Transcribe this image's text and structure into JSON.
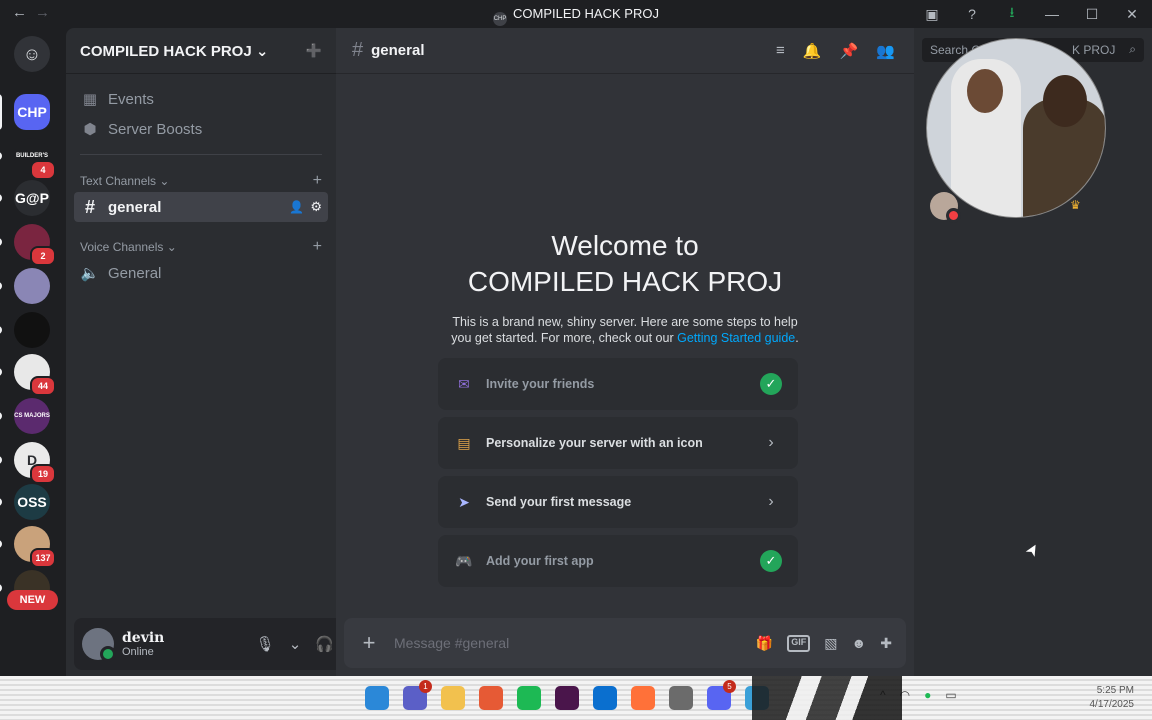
{
  "titlebar": {
    "back_icon": "←",
    "forward_icon": "→",
    "server_icon_text": "CHP",
    "title": "COMPILED HACK PROJ",
    "inbox_icon": "▣",
    "help_icon": "?",
    "download_icon": "⭳",
    "minimize": "—",
    "maximize": "☐",
    "close": "✕"
  },
  "guilds": {
    "discord_home_icon": "☺",
    "active_label": "CHP",
    "items": [
      {
        "label": "CHP",
        "color": "#5865f2",
        "badge": ""
      },
      {
        "label": "BUILDER'S",
        "color": "#1e1f22",
        "badge": "4"
      },
      {
        "label": "G@P",
        "color": "#2b2d31",
        "badge": ""
      },
      {
        "label": "",
        "color": "#7a2540",
        "badge": "2"
      },
      {
        "label": "",
        "color": "#8a86b5",
        "badge": ""
      },
      {
        "label": "",
        "color": "#111111",
        "badge": ""
      },
      {
        "label": "",
        "color": "#e8e8e8",
        "badge": "44"
      },
      {
        "label": "CS MAJORS",
        "color": "#5b2a6e",
        "badge": ""
      },
      {
        "label": "D",
        "color": "#eaeaea",
        "badge": "19"
      },
      {
        "label": "OSS",
        "color": "#1d3b44",
        "badge": ""
      },
      {
        "label": "",
        "color": "#c9a27b",
        "badge": "137"
      },
      {
        "label": "",
        "color": "#3a3226",
        "badge": ""
      }
    ],
    "new_tag": "NEW"
  },
  "sidebar": {
    "server_name": "COMPILED HACK PROJ",
    "chevron": "⌄",
    "invite_icon": "➕",
    "events_label": "Events",
    "boosts_label": "Server Boosts",
    "text_category": "Text Channels",
    "voice_category": "Voice Channels",
    "add_icon": "+",
    "text_channels": [
      {
        "name": "general"
      }
    ],
    "voice_channels": [
      {
        "name": "General"
      }
    ]
  },
  "user": {
    "name": "devin",
    "status": "Online",
    "mic_icon": "🎙",
    "headset_icon": "🎧",
    "settings_icon": "⚙"
  },
  "channel_header": {
    "hash": "#",
    "name": "general",
    "threads_icon": "≡",
    "bell_icon": "🔔",
    "pin_icon": "📌",
    "members_icon": "👥"
  },
  "search": {
    "placeholder": "Search C",
    "suffix": "K PROJ",
    "icon": "⌕"
  },
  "welcome": {
    "title_line1": "Welcome to",
    "title_line2": "COMPILED HACK PROJ",
    "desc_prefix": "This is a brand new, shiny server. Here are some steps to help you get started. For more, check out our ",
    "desc_link": "Getting Started guide",
    "desc_suffix": "."
  },
  "steps": [
    {
      "label": "Invite your friends",
      "icon": "✉",
      "done": true
    },
    {
      "label": "Personalize your server with an icon",
      "icon": "▤",
      "done": false
    },
    {
      "label": "Send your first message",
      "icon": "➤",
      "done": false
    },
    {
      "label": "Add your first app",
      "icon": "🎮",
      "done": true
    }
  ],
  "step_end_icons": {
    "check": "✓",
    "chevron": "›"
  },
  "composer": {
    "plus": "+",
    "placeholder": "Message #general",
    "gift_icon": "🎁",
    "gif_label": "GIF",
    "sticker_icon": "▧",
    "emoji_icon": "☻",
    "apps_icon": "✚"
  },
  "members": {
    "crown_icon": "♛",
    "cursor_icon": "➤"
  },
  "taskbar": {
    "apps": [
      {
        "name": "start",
        "color": "#2b88d8",
        "badge": ""
      },
      {
        "name": "teams",
        "color": "#5b5fc7",
        "badge": "1"
      },
      {
        "name": "files",
        "color": "#f2c14e",
        "badge": ""
      },
      {
        "name": "store",
        "color": "#e65a35",
        "badge": ""
      },
      {
        "name": "spotify",
        "color": "#1db954",
        "badge": ""
      },
      {
        "name": "slack",
        "color": "#4a154b",
        "badge": ""
      },
      {
        "name": "vscode",
        "color": "#0a6fcf",
        "badge": ""
      },
      {
        "name": "firefox",
        "color": "#ff7139",
        "badge": ""
      },
      {
        "name": "settings",
        "color": "#6b6b6b",
        "badge": ""
      },
      {
        "name": "discord",
        "color": "#5865f2",
        "badge": "5"
      },
      {
        "name": "notes",
        "color": "#3aa0d8",
        "badge": ""
      }
    ],
    "tray_chevron": "^",
    "time": "5:25 PM",
    "date": "4/17/2025"
  }
}
